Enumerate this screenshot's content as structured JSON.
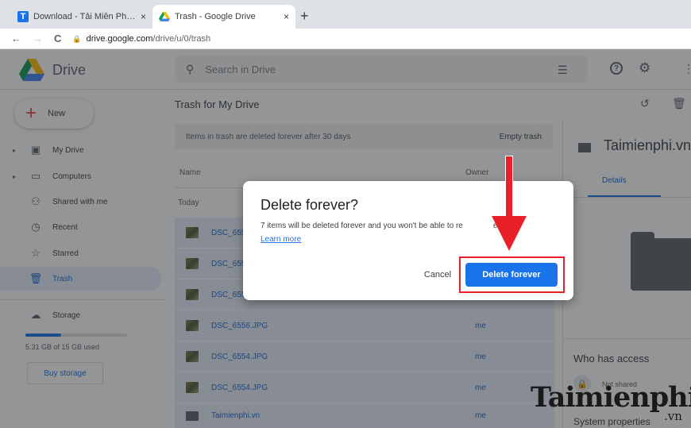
{
  "browser": {
    "tabs": [
      {
        "favicon": "T",
        "title": "Download - Tải Miễn Phí VN - Ph",
        "close": "×"
      },
      {
        "favicon": "drive-logo",
        "title": "Trash - Google Drive",
        "close": "×"
      }
    ],
    "new_tab": "+",
    "back": "←",
    "forward": "→",
    "reload": "C",
    "url_host": "drive.google.com",
    "url_path": "/drive/u/0/trash"
  },
  "header": {
    "app_name": "Drive",
    "search_placeholder": "Search in Drive",
    "help_label": "?"
  },
  "sidebar": {
    "new_label": "New",
    "items": [
      {
        "label": "My Drive",
        "icon": "my-drive-icon",
        "glyph": "▣",
        "expand": "▸"
      },
      {
        "label": "Computers",
        "icon": "computer-icon",
        "glyph": "▭",
        "expand": "▸"
      },
      {
        "label": "Shared with me",
        "icon": "people-icon",
        "glyph": "⚇"
      },
      {
        "label": "Recent",
        "icon": "clock-icon",
        "glyph": "◷"
      },
      {
        "label": "Starred",
        "icon": "star-icon",
        "glyph": "☆"
      },
      {
        "label": "Trash",
        "icon": "trash-icon",
        "glyph": "🗑"
      }
    ],
    "storage_label": "Storage",
    "storage_used": "5.31 GB of 15 GB used",
    "storage_fraction": 0.354,
    "buy_storage": "Buy storage"
  },
  "main": {
    "title": "Trash for My Drive",
    "banner_text": "Items in trash are deleted forever after 30 days",
    "empty_trash": "Empty trash",
    "col_name": "Name",
    "col_owner": "Owner",
    "group_today": "Today",
    "rows": [
      {
        "name": "DSC_655",
        "owner": "",
        "type": "image"
      },
      {
        "name": "DSC_655",
        "owner": "",
        "type": "image"
      },
      {
        "name": "DSC_655",
        "owner": "",
        "type": "image"
      },
      {
        "name": "DSC_6556.JPG",
        "owner": "me",
        "type": "image"
      },
      {
        "name": "DSC_6554.JPG",
        "owner": "me",
        "type": "image"
      },
      {
        "name": "DSC_6554.JPG",
        "owner": "me",
        "type": "image"
      },
      {
        "name": "Taimienphi.vn",
        "owner": "me",
        "type": "folder"
      }
    ]
  },
  "details": {
    "folder_name": "Taimienphi.vn",
    "tab_details": "Details",
    "who_has_access": "Who has access",
    "not_shared": "Not shared",
    "system_properties": "System properties"
  },
  "dialog": {
    "title": "Delete forever?",
    "message": "7 items will be deleted forever and you won't be able to re",
    "message_tail": "em.",
    "learn_more": "Learn more",
    "cancel": "Cancel",
    "confirm": "Delete forever"
  },
  "watermark": {
    "brand": "Taimienphi",
    "suffix": ".vn"
  },
  "colors": {
    "accent": "#1a73e8",
    "annotation_red": "#e8202a"
  }
}
